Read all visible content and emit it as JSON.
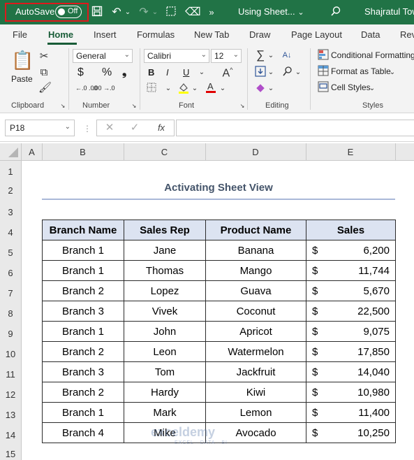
{
  "titlebar": {
    "autosave_label": "AutoSave",
    "autosave_state": "Off",
    "doc_title": "Using Sheet...",
    "user": "Shajratul Tow",
    "bg_color": "#217346"
  },
  "menu": {
    "tabs": [
      "File",
      "Home",
      "Insert",
      "Formulas",
      "New Tab",
      "Draw",
      "Page Layout",
      "Data",
      "Rev"
    ],
    "active": "Home"
  },
  "ribbon": {
    "clipboard": {
      "label": "Clipboard",
      "paste": "Paste"
    },
    "number": {
      "label": "Number",
      "format": "General",
      "dollar": "$",
      "percent": "%",
      "comma": "❟",
      "inc_decimal": "←.0 .00",
      "dec_decimal": ".00 →.0"
    },
    "font": {
      "label": "Font",
      "font_name": "Calibri",
      "font_size": "12",
      "bold": "B",
      "italic": "I",
      "underline": "U",
      "font_color": "A"
    },
    "editing": {
      "label": "Editing"
    },
    "styles": {
      "label": "Styles",
      "conditional": "Conditional Formatting",
      "format_table": "Format as Table",
      "cell_styles": "Cell Styles"
    }
  },
  "formula_bar": {
    "name_box": "P18",
    "fx": "fx",
    "value": ""
  },
  "grid": {
    "columns": [
      "A",
      "B",
      "C",
      "D",
      "E"
    ],
    "rows": [
      "1",
      "2",
      "3",
      "4",
      "5",
      "6",
      "7",
      "8",
      "9",
      "10",
      "11",
      "12",
      "13",
      "14",
      "15"
    ]
  },
  "sheet": {
    "title": "Activating Sheet View",
    "headers": [
      "Branch Name",
      "Sales Rep",
      "Product Name",
      "Sales"
    ],
    "currency": "$",
    "rows": [
      {
        "branch": "Branch 1",
        "rep": "Jane",
        "product": "Banana",
        "sales": "6,200"
      },
      {
        "branch": "Branch 1",
        "rep": "Thomas",
        "product": "Mango",
        "sales": "11,744"
      },
      {
        "branch": "Branch 2",
        "rep": "Lopez",
        "product": "Guava",
        "sales": "5,670"
      },
      {
        "branch": "Branch 3",
        "rep": "Vivek",
        "product": "Coconut",
        "sales": "22,500"
      },
      {
        "branch": "Branch 1",
        "rep": "John",
        "product": "Apricot",
        "sales": "9,075"
      },
      {
        "branch": "Branch 2",
        "rep": "Leon",
        "product": "Watermelon",
        "sales": "17,850"
      },
      {
        "branch": "Branch 3",
        "rep": "Tom",
        "product": "Jackfruit",
        "sales": "14,040"
      },
      {
        "branch": "Branch 2",
        "rep": "Hardy",
        "product": "Kiwi",
        "sales": "10,980"
      },
      {
        "branch": "Branch 1",
        "rep": "Mark",
        "product": "Lemon",
        "sales": "11,400"
      },
      {
        "branch": "Branch 4",
        "rep": "Mike",
        "product": "Avocado",
        "sales": "10,250"
      }
    ]
  },
  "watermark": {
    "name": "exceldemy",
    "tagline": "EXCEL · DATA · BI"
  }
}
